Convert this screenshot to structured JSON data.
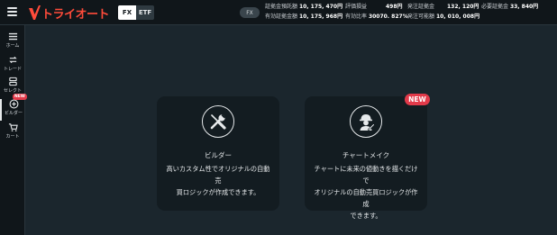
{
  "header": {
    "logo_text": "トライオート",
    "tabs": [
      {
        "label": "FX",
        "active": true
      },
      {
        "label": "ETF",
        "active": false
      }
    ],
    "market_pill": "FX",
    "account": {
      "row1": [
        {
          "label": "証拠金預託額",
          "value": "10, 175, 470円"
        },
        {
          "label": "評価損益",
          "value": "498円"
        },
        {
          "label": "発注証拠金",
          "value": "132, 120円"
        },
        {
          "label": "必要証拠金",
          "value": "33, 840円"
        }
      ],
      "row2": [
        {
          "label": "有効証拠金額",
          "value": "10, 175, 968円"
        },
        {
          "label": "有効比率",
          "value": "30070. 827%"
        },
        {
          "label": "発注可能額",
          "value": "10, 010, 008円"
        }
      ]
    }
  },
  "sidebar": {
    "items": [
      {
        "label": "ホーム",
        "icon": "home-icon"
      },
      {
        "label": "トレード",
        "icon": "trade-icon"
      },
      {
        "label": "セレクト",
        "icon": "select-icon"
      },
      {
        "label": "ビルダー",
        "icon": "builder-plus-icon",
        "badge": "NEW",
        "active": true
      },
      {
        "label": "カート",
        "icon": "cart-icon"
      }
    ]
  },
  "cards": {
    "builder": {
      "icon": "tools-icon",
      "title": "ビルダー",
      "desc_line1": "高いカスタム性でオリジナルの自動売",
      "desc_line2": "買ロジックが作成できます。"
    },
    "chart_make": {
      "icon": "worker-icon",
      "badge": "NEW",
      "title": "チャートメイク",
      "desc_line1": "チャートに未来の値動きを描くだけで",
      "desc_line2": "オリジナルの自動売買ロジックが作成",
      "desc_line3": "できます。"
    }
  },
  "colors": {
    "brand": "#ff4b3a",
    "badge": "#e23a4a",
    "background": "#1b262d",
    "card": "#131c21"
  }
}
